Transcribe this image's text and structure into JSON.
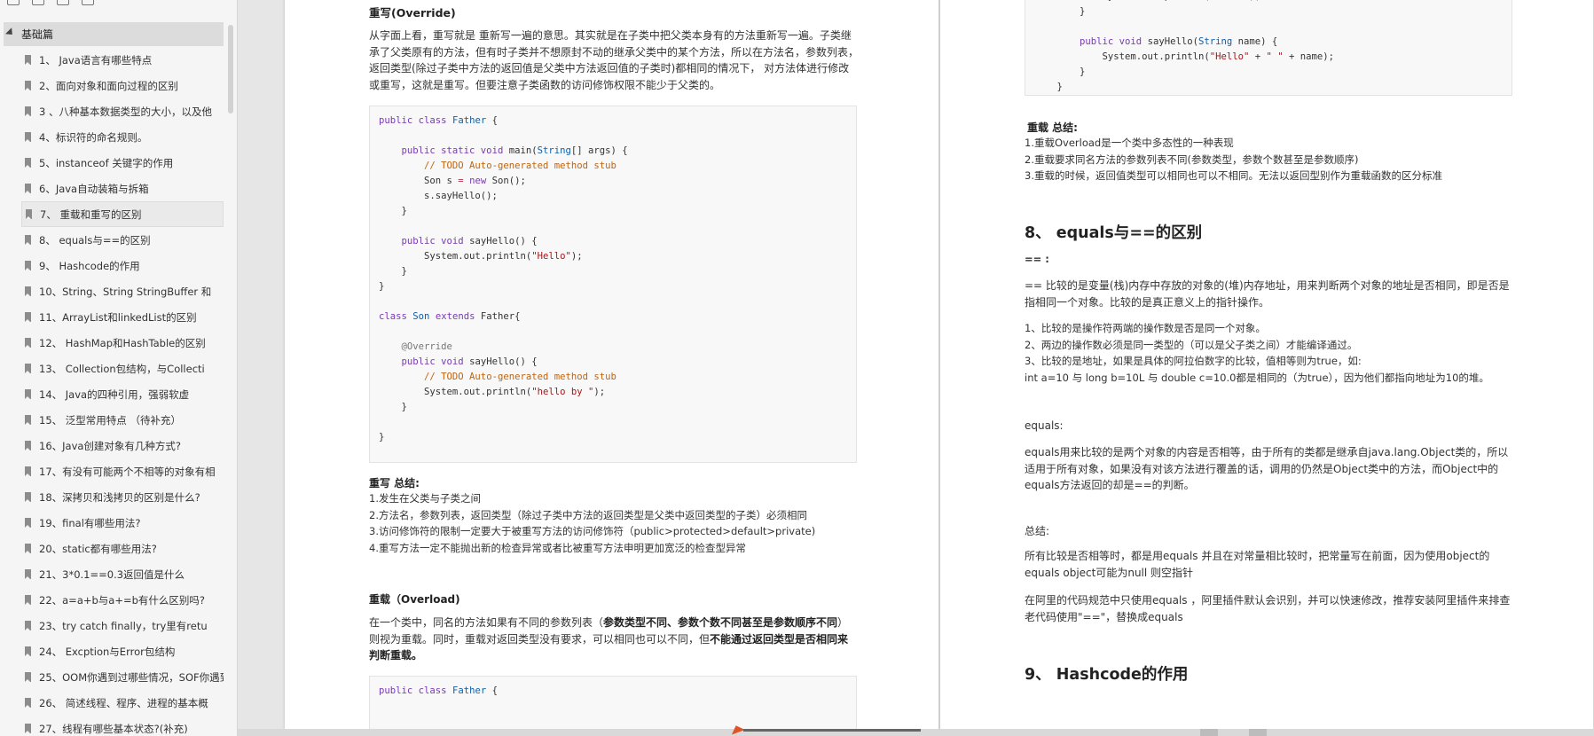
{
  "sidebar": {
    "section_title": "基础篇",
    "items": [
      {
        "label": "1、 Java语言有哪些特点"
      },
      {
        "label": "2、面向对象和面向过程的区别"
      },
      {
        "label": "3 、八种基本数据类型的大小，以及他"
      },
      {
        "label": "4、标识符的命名规则。"
      },
      {
        "label": "5、instanceof 关键字的作用"
      },
      {
        "label": "6、Java自动装箱与拆箱"
      },
      {
        "label": "7、 重载和重写的区别"
      },
      {
        "label": "8、 equals与==的区别"
      },
      {
        "label": "9、 Hashcode的作用"
      },
      {
        "label": "10、String、String StringBuffer 和"
      },
      {
        "label": "11、ArrayList和linkedList的区别"
      },
      {
        "label": "12、 HashMap和HashTable的区别"
      },
      {
        "label": "13、 Collection包结构，与Collecti"
      },
      {
        "label": "14、 Java的四种引用，强弱软虚"
      },
      {
        "label": "15、 泛型常用特点 （待补充）"
      },
      {
        "label": "16、Java创建对象有几种方式?"
      },
      {
        "label": "17、有没有可能两个不相等的对象有相"
      },
      {
        "label": "18、深拷贝和浅拷贝的区别是什么?"
      },
      {
        "label": "19、final有哪些用法?"
      },
      {
        "label": "20、static都有哪些用法?"
      },
      {
        "label": "21、3*0.1==0.3返回值是什么"
      },
      {
        "label": "22、a=a+b与a+=b有什么区别吗?"
      },
      {
        "label": "23、try catch finally，try里有retu"
      },
      {
        "label": "24、 Excption与Error包结构"
      },
      {
        "label": "25、OOM你遇到过哪些情况，SOF你遇到"
      },
      {
        "label": "26、 简述线程、程序、进程的基本概"
      },
      {
        "label": "27、线程有哪些基本状态?(补充)"
      }
    ]
  },
  "left_page": {
    "override_heading": "重写(Override)",
    "override_para": "从字面上看，重写就是 重新写一遍的意思。其实就是在子类中把父类本身有的方法重新写一遍。子类继承了父类原有的方法，但有时子类并不想原封不动的继承父类中的某个方法，所以在方法名，参数列表，返回类型(除过子类中方法的返回值是父类中方法返回值的子类时)都相同的情况下， 对方法体进行修改或重写，这就是重写。但要注意子类函数的访问修饰权限不能少于父类的。",
    "override_summary_title": "重写 总结:",
    "override_summary": [
      "1.发生在父类与子类之间",
      "2.方法名，参数列表，返回类型（除过子类中方法的返回类型是父类中返回类型的子类）必须相同",
      "3.访问修饰符的限制一定要大于被重写方法的访问修饰符（public>protected>default>private)",
      "4.重写方法一定不能抛出新的检查异常或者比被重写方法申明更加宽泛的检查型异常"
    ],
    "overload_heading": "重载（Overload)",
    "overload_para_1": "在一个类中，同名的方法如果有不同的参数列表（",
    "overload_para_bold_1": "参数类型不同、参数个数不同甚至是参数顺序不同",
    "overload_para_2": "）则视为重载。同时，重载对返回类型没有要求，可以相同也可以不同，但",
    "overload_para_bold_2": "不能通过返回类型是否相同来判断重载。",
    "code2_first_line": "public class Father {"
  },
  "right_page": {
    "overload_summary_title": "重载 总结:",
    "overload_summary": [
      "1.重载Overload是一个类中多态性的一种表现",
      "2.重载要求同名方法的参数列表不同(参数类型，参数个数甚至是参数顺序)",
      "3.重载的时候，返回值类型可以相同也可以不相同。无法以返回型别作为重载函数的区分标准"
    ],
    "equals_heading": "8、 equals与==的区别",
    "eqeq_label": "== :",
    "eqeq_para": "== 比较的是变量(栈)内存中存放的对象的(堆)内存地址，用来判断两个对象的地址是否相同，即是否是指相同一个对象。比较的是真正意义上的指针操作。",
    "eqeq_points": [
      "1、比较的是操作符两端的操作数是否是同一个对象。",
      "2、两边的操作数必须是同一类型的（可以是父子类之间）才能编译通过。",
      "3、比较的是地址，如果是具体的阿拉伯数字的比较，值相等则为true，如:",
      "int a=10 与 long b=10L 与 double c=10.0都是相同的（为true），因为他们都指向地址为10的堆。"
    ],
    "equals_label": "equals:",
    "equals_para": "equals用来比较的是两个对象的内容是否相等，由于所有的类都是继承自java.lang.Object类的，所以适用于所有对象，如果没有对该方法进行覆盖的话，调用的仍然是Object类中的方法，而Object中的equals方法返回的却是==的判断。",
    "summary_label": "总结:",
    "summary_para_1": "所有比较是否相等时，都是用equals 并且在对常量相比较时，把常量写在前面，因为使用object的equals  object可能为null  则空指针",
    "summary_para_2": "在阿里的代码规范中只使用equals ，阿里插件默认会识别，并可以快速修改，推荐安装阿里插件来排查老代码使用\"==\"，替换成equals",
    "hashcode_heading": "9、 Hashcode的作用"
  },
  "colors": {
    "keyword": "#7a39b5",
    "type": "#0f5fa8",
    "comment": "#c0640e",
    "string": "#a61717",
    "sidebar_bg": "#f5f5f5",
    "page_bg": "#ffffff"
  },
  "icons": [
    "copy-icon",
    "copy-alt-icon",
    "bookmark-icon",
    "star-icon",
    "bookmark-item-icon",
    "expand-caret-icon"
  ]
}
